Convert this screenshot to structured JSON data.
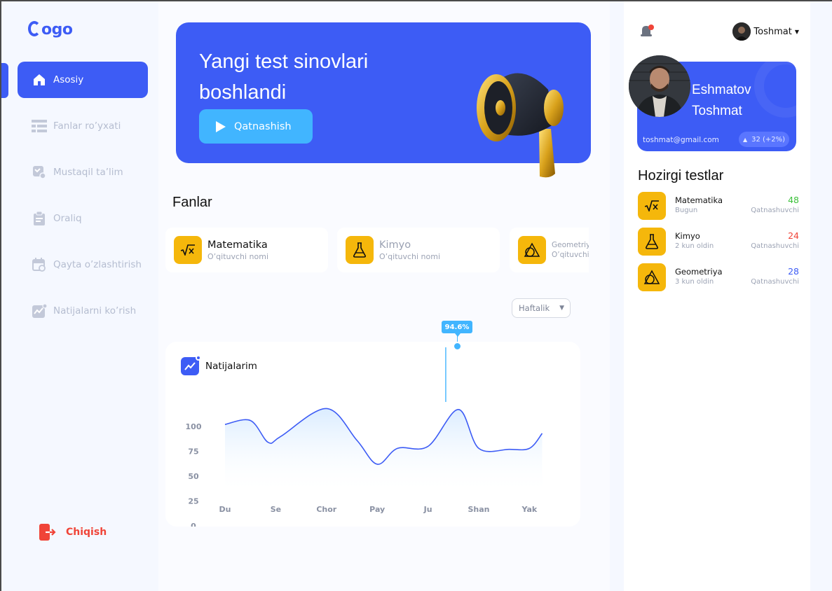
{
  "brand": {
    "logo_text": "Logo",
    "accent": "#3d5cf5",
    "highlight": "#41b5ff",
    "subject_color": "#f5b70b"
  },
  "sidebar": {
    "items": [
      {
        "label": "Asosiy",
        "icon": "home-icon",
        "active": true
      },
      {
        "label": "Fanlar ro’yxati",
        "icon": "list-icon"
      },
      {
        "label": "Mustaqil ta’lim",
        "icon": "self-study-icon"
      },
      {
        "label": "Oraliq",
        "icon": "clipboard-icon"
      },
      {
        "label": "Qayta o’zlashtirish",
        "icon": "calendar-repeat-icon"
      },
      {
        "label": "Natijalarni ko’rish",
        "icon": "results-icon"
      }
    ],
    "logout_label": "Chiqish"
  },
  "hero": {
    "title": "Yangi test sinovlari boshlandi",
    "button_label": "Qatnashish"
  },
  "subjects": {
    "title": "Fanlar",
    "items": [
      {
        "name": "Matematika",
        "teacher": "O’qituvchi nomi",
        "icon": "sqrt-icon"
      },
      {
        "name": "Kimyo",
        "teacher": "O’qituvchi nomi",
        "icon": "flask-icon"
      },
      {
        "name": "Geometriya",
        "teacher": "O’qituvchi nomi",
        "icon": "geometry-icon"
      }
    ]
  },
  "filter": {
    "selected": "Haftalik"
  },
  "results": {
    "title": "Natijalarim",
    "tooltip": "94.6%"
  },
  "chart_data": {
    "type": "area",
    "title": "Natijalarim",
    "categories": [
      "Du",
      "Se",
      "Chor",
      "Pay",
      "Ju",
      "Shan",
      "Yak"
    ],
    "yticks": [
      0,
      25,
      50,
      75,
      100
    ],
    "ylim": [
      0,
      150
    ],
    "x": [
      0,
      0.5,
      0.85,
      1.1,
      2.0,
      2.6,
      3.0,
      3.4,
      4.0,
      4.6,
      5.0,
      5.6,
      6.0,
      6.25
    ],
    "values": [
      102,
      106,
      84,
      90,
      118,
      86,
      62,
      78,
      80,
      117,
      78,
      77,
      78,
      93
    ],
    "highlight": {
      "category": "Ju",
      "label": "94.6%"
    },
    "grid": false,
    "legend": "none",
    "line_color": "#3d5cf5"
  },
  "header": {
    "username": "Toshmat",
    "notification": "bell-icon"
  },
  "profile": {
    "first_name": "Eshmatov",
    "last_name": "Toshmat",
    "email": "toshmat@gmail.com",
    "score": "32 (+2%)"
  },
  "current_tests": {
    "title": "Hozirgi testlar",
    "items": [
      {
        "name": "Matematika",
        "date": "Bugun",
        "count": "48",
        "label": "Qatnashuvchi",
        "color": "#3cc13b",
        "icon": "sqrt-icon"
      },
      {
        "name": "Kimyo",
        "date": "2 kun oldin",
        "count": "24",
        "label": "Qatnashuvchi",
        "color": "#f04438",
        "icon": "flask-icon"
      },
      {
        "name": "Geometriya",
        "date": "3 kun oldin",
        "count": "28",
        "label": "Qatnashuvchi",
        "color": "#3d5cf5",
        "icon": "geometry-icon"
      }
    ]
  }
}
